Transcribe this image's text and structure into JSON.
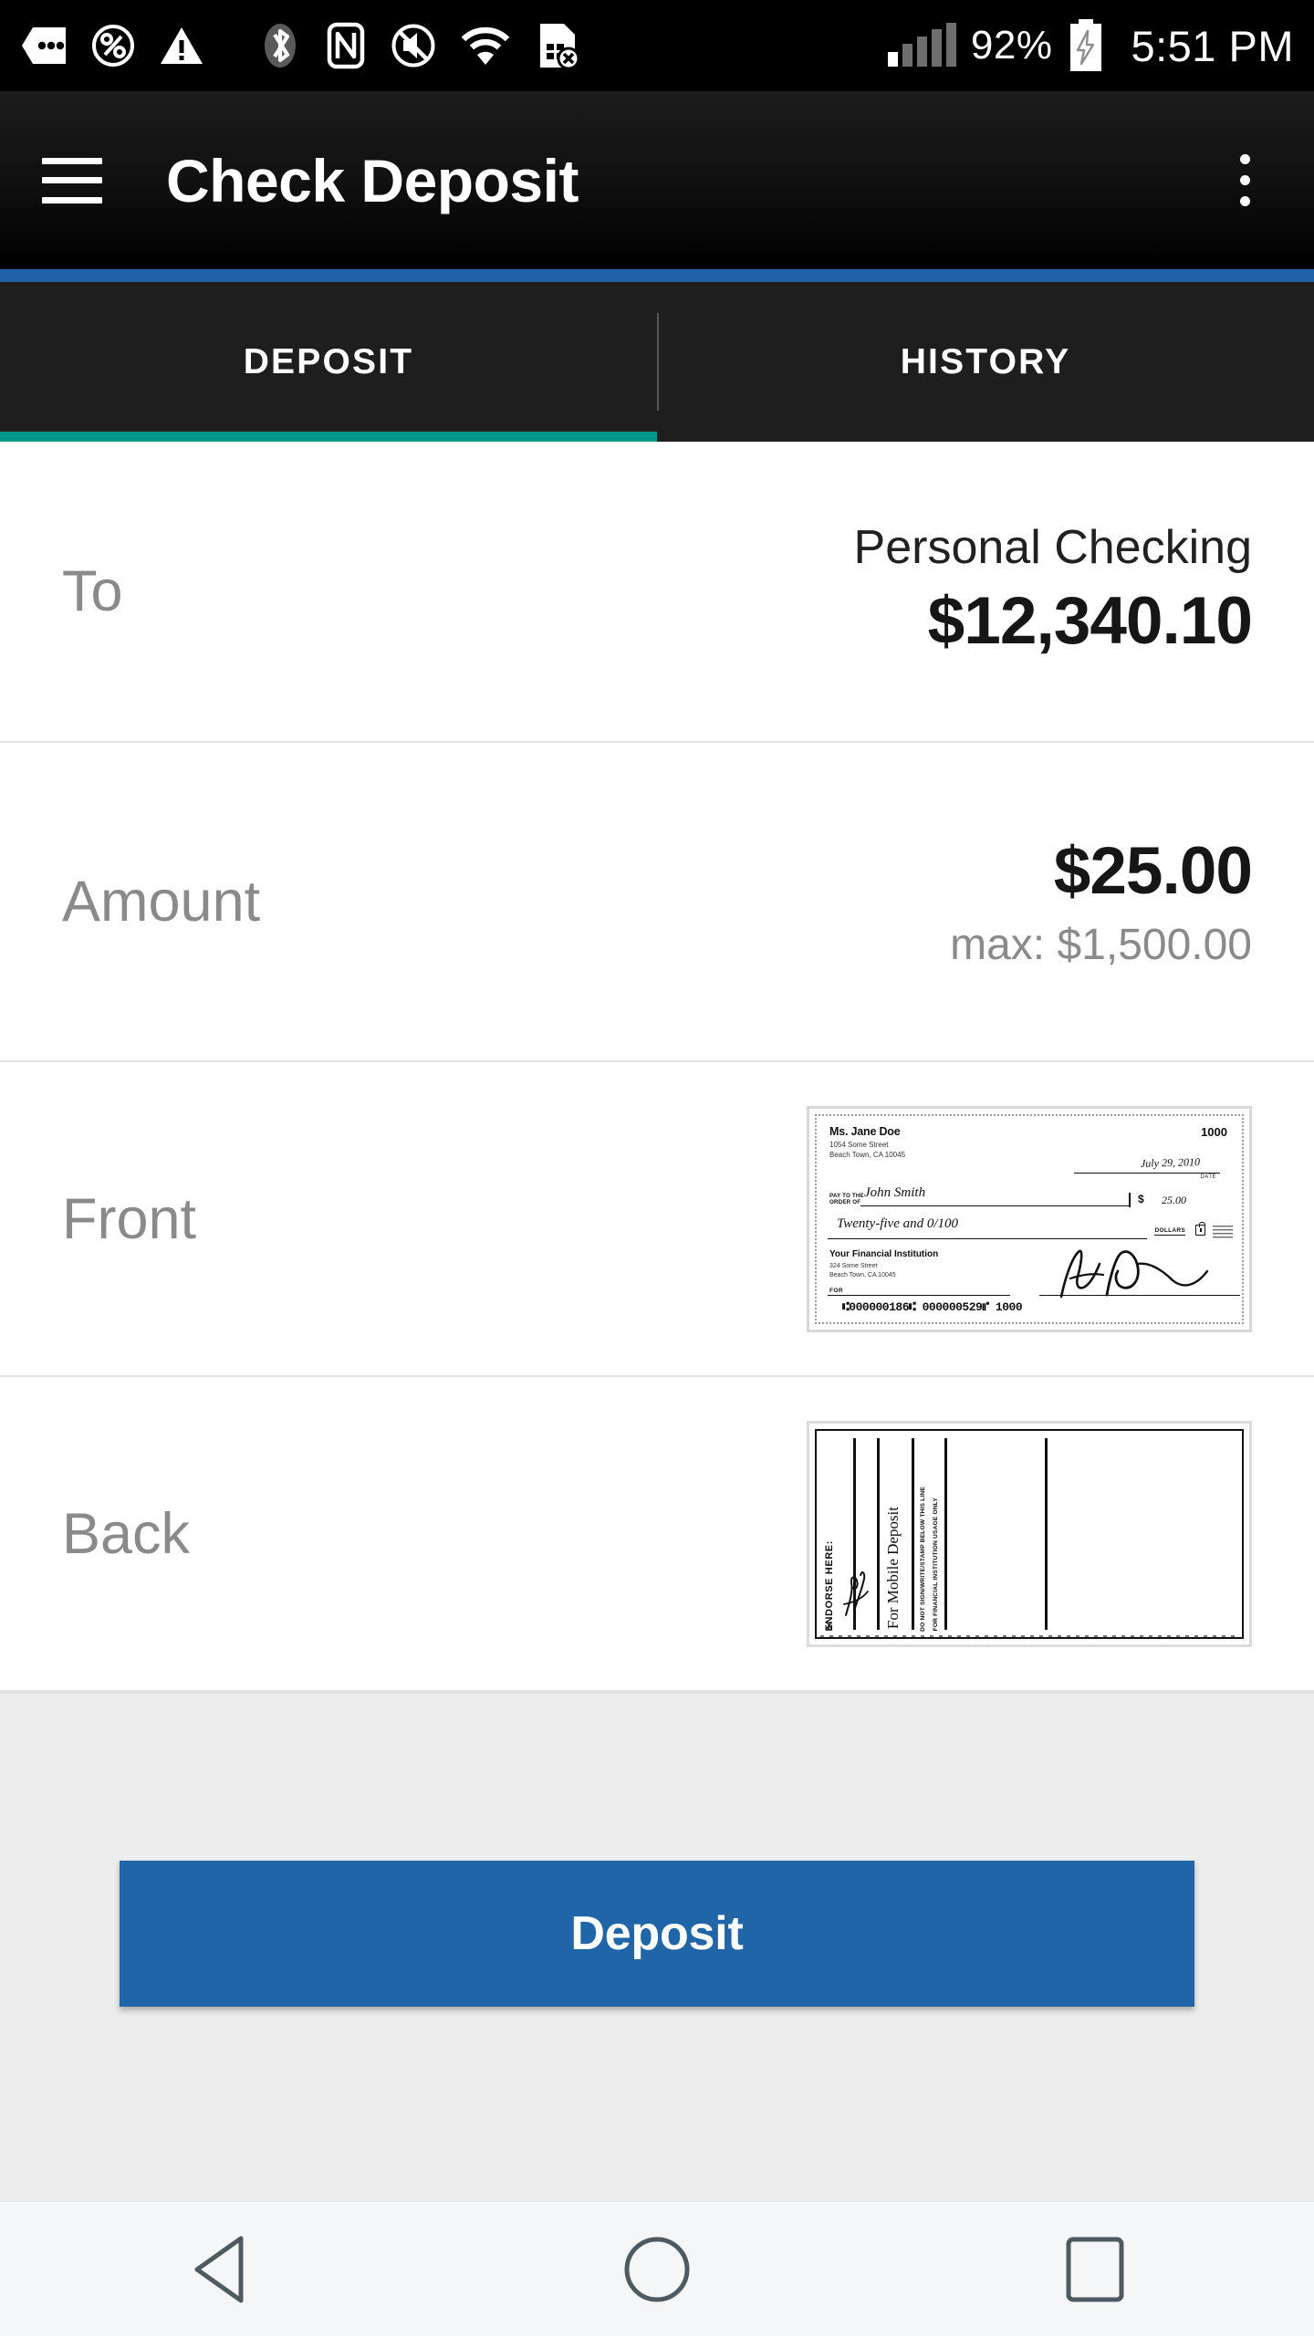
{
  "status_bar": {
    "battery_percent": "92%",
    "time": "5:51 PM",
    "icons": [
      "sms-icon",
      "percent-circle-icon",
      "warning-triangle-icon",
      "bluetooth-icon",
      "nfc-icon",
      "mute-icon",
      "wifi-icon",
      "sim-card-error-icon",
      "signal-bars-icon",
      "battery-charging-icon"
    ]
  },
  "app_bar": {
    "title": "Check Deposit",
    "menu_icon": "hamburger-menu-icon",
    "overflow_icon": "overflow-menu-icon",
    "accent_color": "#2062a8"
  },
  "tabs": {
    "items": [
      {
        "label": "DEPOSIT",
        "active": true
      },
      {
        "label": "HISTORY",
        "active": false
      }
    ],
    "indicator_color": "#009688"
  },
  "form": {
    "to": {
      "label": "To",
      "account_name": "Personal Checking",
      "account_balance": "$12,340.10"
    },
    "amount": {
      "label": "Amount",
      "value": "$25.00",
      "max_text": "max: $1,500.00"
    },
    "front": {
      "label": "Front",
      "image_alt": "check-front-thumbnail"
    },
    "back": {
      "label": "Back",
      "image_alt": "check-back-thumbnail"
    }
  },
  "check_front": {
    "payer_name": "Ms. Jane Doe",
    "payer_address_line1": "1054 Some Street",
    "payer_address_line2": "Beach Town, CA 10045",
    "check_number": "1000",
    "date": "July 29, 2010",
    "date_label": "DATE",
    "pay_to_the_order_of": "PAY TO THE ORDER OF",
    "payee": "John Smith",
    "dollar_sign": "$",
    "amount_numeric": "25.00",
    "amount_words": "Twenty-five and 0/100",
    "dollars_label": "DOLLARS",
    "bank_name": "Your Financial Institution",
    "bank_address_line1": "324 Some Street",
    "bank_address_line2": "Beach Town, CA 10045",
    "for_label": "FOR",
    "micr_line": "⑆000000186⑆ 000000529⑈ 1000"
  },
  "check_back": {
    "endorse_label": "ENDORSE HERE:",
    "x_mark": "X",
    "signature_text": "John Smith",
    "mobile_deposit_text": "For Mobile Deposit",
    "warning_line1": "DO NOT SIGN/WRITE/STAMP BELOW THIS LINE",
    "warning_line2": "FOR FINANCIAL INSTITUTION USAGE ONLY"
  },
  "footer": {
    "deposit_label": "Deposit",
    "button_color": "#1f65a8"
  },
  "nav_bar": {
    "back_icon": "back-triangle-icon",
    "home_icon": "home-circle-icon",
    "recents_icon": "recents-square-icon"
  }
}
